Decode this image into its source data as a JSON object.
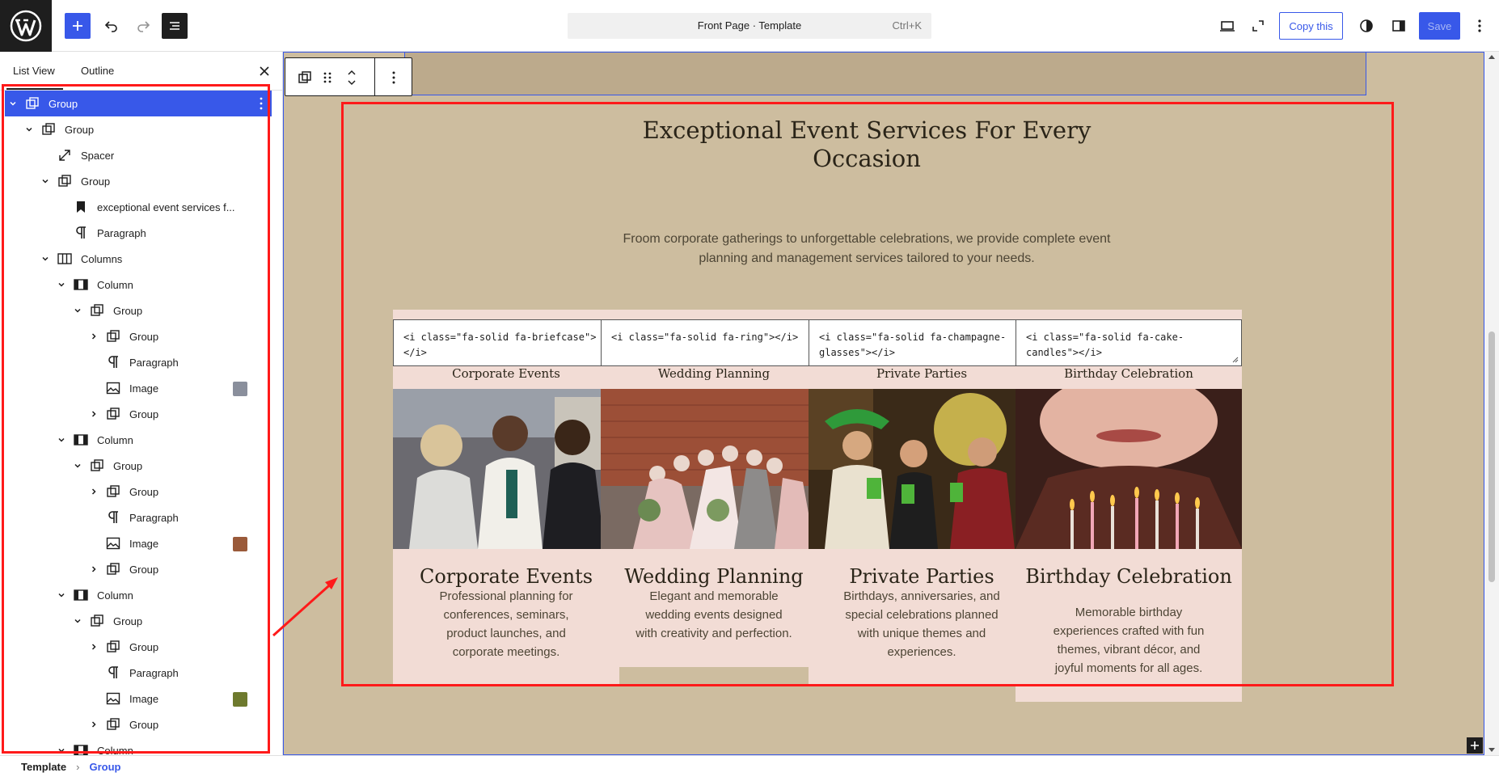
{
  "topbar": {
    "command_title": "Front Page · Template",
    "command_shortcut": "Ctrl+K",
    "copy_label": "Copy this",
    "save_label": "Save"
  },
  "sidebar": {
    "tab_list": "List View",
    "tab_outline": "Outline",
    "tree": [
      {
        "label": "Group",
        "level": 0,
        "chev": "down",
        "icon": "group",
        "selected": true,
        "menu": true
      },
      {
        "label": "Group",
        "level": 1,
        "chev": "down",
        "icon": "group"
      },
      {
        "label": "Spacer",
        "level": 2,
        "chev": "none",
        "icon": "spacer"
      },
      {
        "label": "Group",
        "level": 2,
        "chev": "down",
        "icon": "group"
      },
      {
        "label": "exceptional event services f...",
        "level": 3,
        "chev": "none",
        "icon": "heading"
      },
      {
        "label": "Paragraph",
        "level": 3,
        "chev": "none",
        "icon": "paragraph"
      },
      {
        "label": "Columns",
        "level": 2,
        "chev": "down",
        "icon": "columns"
      },
      {
        "label": "Column",
        "level": 3,
        "chev": "down",
        "icon": "column"
      },
      {
        "label": "Group",
        "level": 4,
        "chev": "down",
        "icon": "group"
      },
      {
        "label": "Group",
        "level": 5,
        "chev": "right",
        "icon": "group"
      },
      {
        "label": "Paragraph",
        "level": 5,
        "chev": "none",
        "icon": "paragraph"
      },
      {
        "label": "Image",
        "level": 5,
        "chev": "none",
        "icon": "image",
        "thumb": "#8a8f9c"
      },
      {
        "label": "Group",
        "level": 5,
        "chev": "right",
        "icon": "group"
      },
      {
        "label": "Column",
        "level": 3,
        "chev": "down",
        "icon": "column"
      },
      {
        "label": "Group",
        "level": 4,
        "chev": "down",
        "icon": "group"
      },
      {
        "label": "Group",
        "level": 5,
        "chev": "right",
        "icon": "group"
      },
      {
        "label": "Paragraph",
        "level": 5,
        "chev": "none",
        "icon": "paragraph"
      },
      {
        "label": "Image",
        "level": 5,
        "chev": "none",
        "icon": "image",
        "thumb": "#9a5a3a"
      },
      {
        "label": "Group",
        "level": 5,
        "chev": "right",
        "icon": "group"
      },
      {
        "label": "Column",
        "level": 3,
        "chev": "down",
        "icon": "column"
      },
      {
        "label": "Group",
        "level": 4,
        "chev": "down",
        "icon": "group"
      },
      {
        "label": "Group",
        "level": 5,
        "chev": "right",
        "icon": "group"
      },
      {
        "label": "Paragraph",
        "level": 5,
        "chev": "none",
        "icon": "paragraph"
      },
      {
        "label": "Image",
        "level": 5,
        "chev": "none",
        "icon": "image",
        "thumb": "#6e7a2e"
      },
      {
        "label": "Group",
        "level": 5,
        "chev": "right",
        "icon": "group"
      },
      {
        "label": "Column",
        "level": 3,
        "chev": "down",
        "icon": "column"
      }
    ]
  },
  "breadcrumb": {
    "root": "Template",
    "current": "Group"
  },
  "section": {
    "heading": "Exceptional Event Services For Every Occasion",
    "subtext": "Froom corporate gatherings to unforgettable celebrations, we provide complete event planning and management services tailored to your needs."
  },
  "cards": [
    {
      "code": "<i class=\"fa-solid fa-briefcase\"></i>",
      "sublabel": "Corporate Events",
      "title": "Corporate Events",
      "desc": "Professional planning for conferences, seminars, product launches, and corporate meetings.",
      "img": "corporate"
    },
    {
      "code": "<i class=\"fa-solid fa-ring\"></i>",
      "sublabel": "Wedding Planning",
      "title": "Wedding Planning",
      "desc": "Elegant and memorable wedding events designed with creativity and perfection.",
      "img": "wedding"
    },
    {
      "code": "<i class=\"fa-solid fa-champagne-glasses\"></i>",
      "sublabel": "Private Parties",
      "title": "Private Parties",
      "desc": "Birthdays, anniversaries, and special celebrations planned with unique themes and experiences.",
      "img": "party"
    },
    {
      "code": "<i class=\"fa-solid fa-cake-candles\"></i>",
      "sublabel": "Birthday Celebration",
      "title": "Birthday Celebration",
      "desc": "Memorable birthday experiences crafted with fun themes, vibrant décor, and joyful moments for all ages.",
      "img": "birthday"
    }
  ],
  "colors": {
    "accent": "#3858e9",
    "canvas_bg": "#cdbd9f",
    "card_bg": "#f2dcd5",
    "annotation_red": "#ff1a1a"
  }
}
